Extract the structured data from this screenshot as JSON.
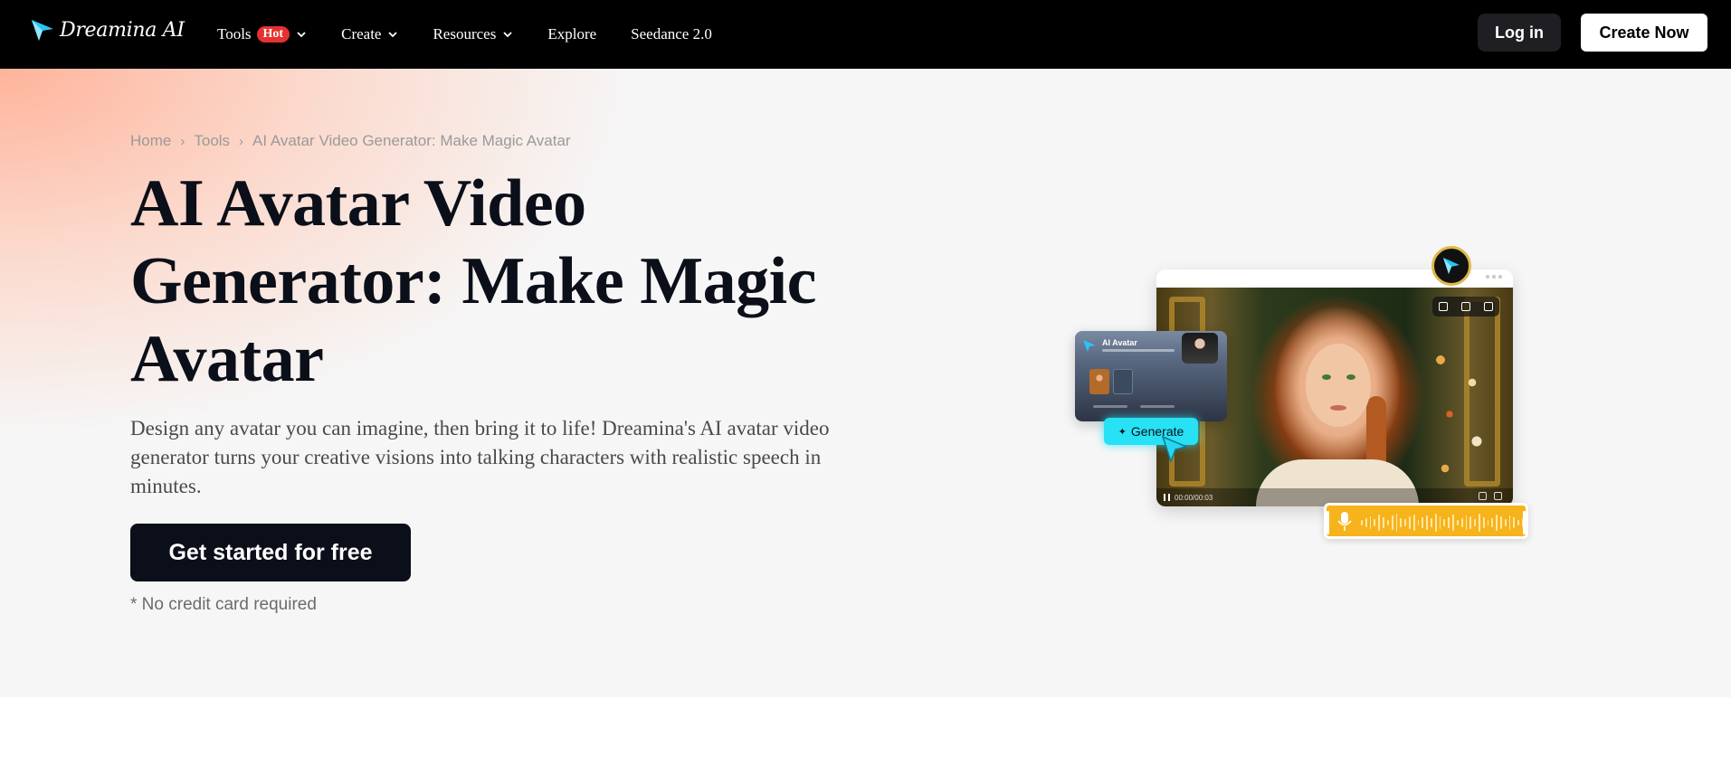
{
  "nav": {
    "logo_text": "Dreamina AI",
    "items": [
      {
        "label": "Tools",
        "has_dropdown": true,
        "badge": "Hot"
      },
      {
        "label": "Create",
        "has_dropdown": true
      },
      {
        "label": "Resources",
        "has_dropdown": true
      },
      {
        "label": "Explore",
        "has_dropdown": false
      },
      {
        "label": "Seedance 2.0",
        "has_dropdown": false
      }
    ],
    "login_label": "Log in",
    "create_label": "Create Now"
  },
  "breadcrumb": [
    "Home",
    "Tools",
    "AI Avatar Video Generator: Make Magic Avatar"
  ],
  "hero": {
    "title": "AI Avatar Video Generator: Make Magic Avatar",
    "description": "Design any avatar you can imagine, then bring it to life! Dreamina's AI avatar video generator turns your creative visions into talking characters with realistic speech in minutes.",
    "cta_label": "Get started for free",
    "note": "* No credit card required"
  },
  "illustration": {
    "panel_title": "AI Avatar",
    "generate_label": "Generate",
    "player_time": "00:00/00:03"
  },
  "colors": {
    "nav_bg": "#000000",
    "hot_badge": "#e5322f",
    "cta_bg": "#0b0f19",
    "generate_accent": "#27e1f5",
    "audio_accent": "#f6b31b"
  },
  "icons": [
    "dreamina-logo-icon",
    "chevron-down-icon",
    "play-pause-icon",
    "microphone-icon",
    "cursor-arrow-icon",
    "sparkle-icon"
  ]
}
